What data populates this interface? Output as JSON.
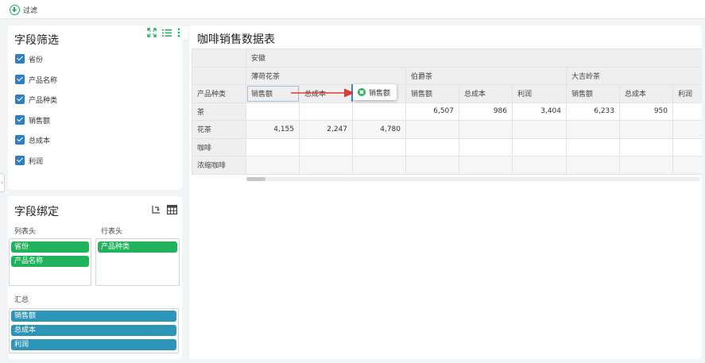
{
  "toolbar": {
    "filter_label": "过滤"
  },
  "field_filter": {
    "title": "字段筛选",
    "fields": [
      "省份",
      "产品名称",
      "产品种类",
      "销售额",
      "总成本",
      "利润"
    ]
  },
  "field_binding": {
    "title": "字段绑定",
    "column_header_label": "列表头",
    "row_header_label": "行表头",
    "summary_label": "汇总",
    "column_fields": [
      "省份",
      "产品名称"
    ],
    "row_fields": [
      "产品种类"
    ],
    "summary_fields": [
      "销售额",
      "总成本",
      "利润"
    ]
  },
  "main": {
    "title": "咖啡销售数据表",
    "province": "安徽",
    "products": [
      "薄荷花茶",
      "伯爵茶",
      "大吉岭茶"
    ],
    "row_header": "产品种类",
    "measures": [
      "销售额",
      "总成本",
      "利润",
      "销售额",
      "总成本",
      "利润",
      "销售额",
      "总成本",
      "利润"
    ],
    "rows": [
      {
        "label": "茶",
        "cells": [
          "",
          "",
          "",
          "6,507",
          "986",
          "3,404",
          "6,233",
          "950",
          ""
        ]
      },
      {
        "label": "花茶",
        "cells": [
          "4,155",
          "2,247",
          "4,780",
          "",
          "",
          "",
          "",
          "",
          ""
        ]
      },
      {
        "label": "咖啡",
        "cells": [
          "",
          "",
          "",
          "",
          "",
          "",
          "",
          "",
          ""
        ]
      },
      {
        "label": "浓缩咖啡",
        "cells": [
          "",
          "",
          "",
          "",
          "",
          "",
          "",
          "",
          ""
        ]
      }
    ],
    "drag_ghost_label": "销售额"
  },
  "colors": {
    "accent_green": "#21b25c",
    "summary_blue": "#2c95b8",
    "checkbox_blue": "#2f7fc1",
    "arrow_red": "#e03a3a"
  }
}
